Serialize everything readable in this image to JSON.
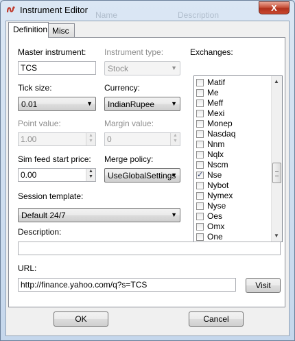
{
  "window": {
    "title": "Instrument Editor",
    "close_glyph": "X"
  },
  "background_ghost": {
    "name": "Name",
    "description": "Description"
  },
  "tabs": [
    {
      "label": "Definition",
      "active": true
    },
    {
      "label": "Misc",
      "active": false
    }
  ],
  "fields": {
    "master_instrument": {
      "label": "Master instrument:",
      "value": "TCS"
    },
    "instrument_type": {
      "label": "Instrument type:",
      "value": "Stock",
      "enabled": false
    },
    "tick_size": {
      "label": "Tick size:",
      "value": "0.01"
    },
    "currency": {
      "label": "Currency:",
      "value": "IndianRupee"
    },
    "point_value": {
      "label": "Point value:",
      "value": "1.00",
      "enabled": false
    },
    "margin_value": {
      "label": "Margin value:",
      "value": "0",
      "enabled": false
    },
    "sim_feed_start_price": {
      "label": "Sim feed start price:",
      "value": "0.00"
    },
    "merge_policy": {
      "label": "Merge policy:",
      "value": "UseGlobalSettings"
    },
    "session_template": {
      "label": "Session template:",
      "value": "Default 24/7"
    },
    "description": {
      "label": "Description:",
      "value": ""
    },
    "url": {
      "label": "URL:",
      "value": "http://finance.yahoo.com/q?s=TCS"
    }
  },
  "exchanges": {
    "label": "Exchanges:",
    "items": [
      {
        "name": "Matif",
        "checked": false
      },
      {
        "name": "Me",
        "checked": false
      },
      {
        "name": "Meff",
        "checked": false
      },
      {
        "name": "Mexi",
        "checked": false
      },
      {
        "name": "Monep",
        "checked": false
      },
      {
        "name": "Nasdaq",
        "checked": false
      },
      {
        "name": "Nnm",
        "checked": false
      },
      {
        "name": "Nqlx",
        "checked": false
      },
      {
        "name": "Nscm",
        "checked": false
      },
      {
        "name": "Nse",
        "checked": true
      },
      {
        "name": "Nybot",
        "checked": false
      },
      {
        "name": "Nymex",
        "checked": false
      },
      {
        "name": "Nyse",
        "checked": false
      },
      {
        "name": "Oes",
        "checked": false
      },
      {
        "name": "Omx",
        "checked": false
      },
      {
        "name": "One",
        "checked": false
      }
    ]
  },
  "buttons": {
    "visit": "Visit",
    "ok": "OK",
    "cancel": "Cancel"
  },
  "icons": {
    "app": "instrument-app-icon",
    "dropdown": "chevron-down-icon",
    "check": "checkmark-icon"
  },
  "colors": {
    "close_button": "#c8533c",
    "title_background": "#dbe7f4",
    "check_mark": "#2b3c6b"
  }
}
